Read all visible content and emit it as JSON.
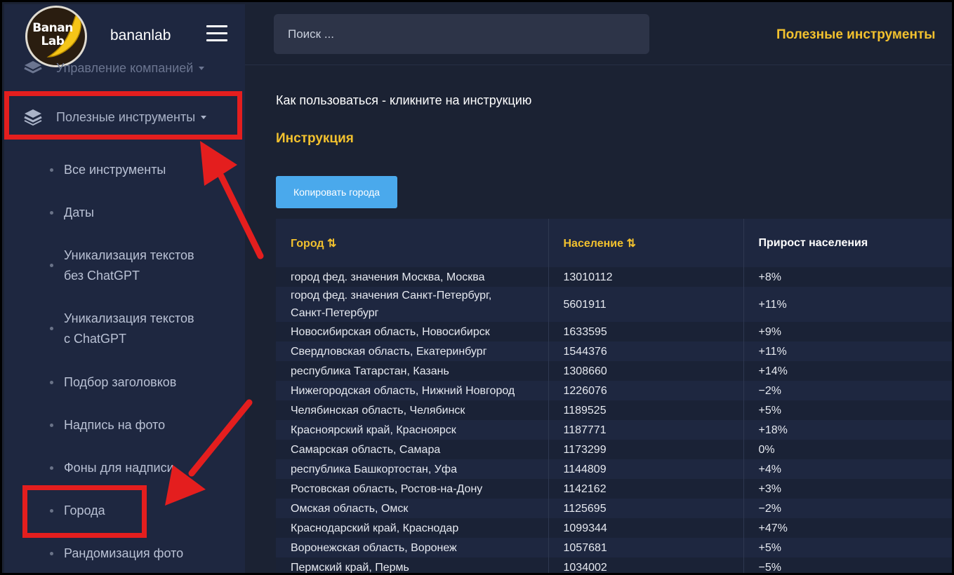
{
  "brand": {
    "logo_text_line1": "Banan",
    "logo_text_line2": "Lab",
    "name": "bananlab"
  },
  "search": {
    "placeholder": "Поиск ..."
  },
  "header": {
    "title": "Полезные инструменты"
  },
  "sidebar": {
    "company_menu": "Управление компанией",
    "tools_menu": "Полезные инструменты",
    "items": [
      {
        "label": "Все инструменты"
      },
      {
        "label": "Даты"
      },
      {
        "label": "Уникализация текстов",
        "label2": "без ChatGPT"
      },
      {
        "label": "Уникализация текстов",
        "label2": "с ChatGPT"
      },
      {
        "label": "Подбор заголовков"
      },
      {
        "label": "Надпись на фото"
      },
      {
        "label": "Фоны для надписи"
      },
      {
        "label": "Города"
      },
      {
        "label": "Рандомизация фото"
      }
    ]
  },
  "main": {
    "howto": "Как пользоваться - кликните на инструкцию",
    "instruction_link": "Инструкция",
    "copy_button": "Копировать города"
  },
  "table": {
    "headers": [
      "Город ⇅",
      "Население ⇅",
      "Прирост населения"
    ],
    "rows": [
      [
        "город фед. значения Москва, Москва",
        "13010112",
        "+8%"
      ],
      [
        "город фед. значения Санкт-Петербург, Санкт-Петербург",
        "5601911",
        "+11%"
      ],
      [
        "Новосибирская область, Новосибирск",
        "1633595",
        "+9%"
      ],
      [
        "Свердловская область, Екатеринбург",
        "1544376",
        "+11%"
      ],
      [
        "республика Татарстан, Казань",
        "1308660",
        "+14%"
      ],
      [
        "Нижегородская область, Нижний Новгород",
        "1226076",
        "−2%"
      ],
      [
        "Челябинская область, Челябинск",
        "1189525",
        "+5%"
      ],
      [
        "Красноярский край, Красноярск",
        "1187771",
        "+18%"
      ],
      [
        "Самарская область, Самара",
        "1173299",
        "0%"
      ],
      [
        "республика Башкортостан, Уфа",
        "1144809",
        "+4%"
      ],
      [
        "Ростовская область, Ростов-на-Дону",
        "1142162",
        "+3%"
      ],
      [
        "Омская область, Омск",
        "1125695",
        "−2%"
      ],
      [
        "Краснодарский край, Краснодар",
        "1099344",
        "+47%"
      ],
      [
        "Воронежская область, Воронеж",
        "1057681",
        "+5%"
      ],
      [
        "Пермский край, Пермь",
        "1034002",
        "−5%"
      ]
    ]
  },
  "colors": {
    "accent": "#f2c12e",
    "button": "#4aa9ec",
    "annotation": "#e41e1e",
    "background": "#1b2233"
  }
}
